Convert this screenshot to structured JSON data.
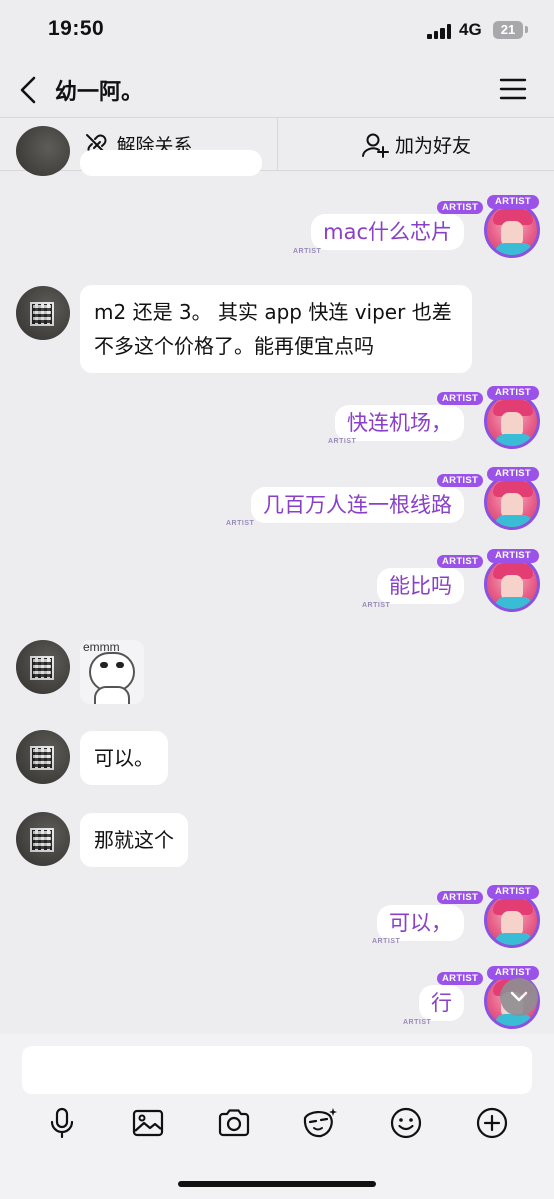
{
  "status_bar": {
    "time": "19:50",
    "network": "4G",
    "battery": "21"
  },
  "nav": {
    "title": "幼一阿。"
  },
  "actions": {
    "unlink": "解除关系",
    "add_friend": "加为好友"
  },
  "badge_text": "ARTIST",
  "messages": [
    {
      "side": "out",
      "text": "mac什么芯片"
    },
    {
      "side": "in",
      "text": "m2 还是 3。 其实 app 快连 viper 也差不多这个价格了。能再便宜点吗"
    },
    {
      "side": "out",
      "text": "快连机场，"
    },
    {
      "side": "out",
      "text": "几百万人连一根线路"
    },
    {
      "side": "out",
      "text": "能比吗"
    },
    {
      "side": "in",
      "type": "sticker",
      "text": "emmm"
    },
    {
      "side": "in",
      "text": "可以。"
    },
    {
      "side": "in",
      "text": "那就这个"
    },
    {
      "side": "out",
      "text": "可以，"
    },
    {
      "side": "out",
      "text": "行"
    }
  ],
  "input": {
    "value": "",
    "placeholder": ""
  },
  "toolbar": [
    "microphone-icon",
    "image-icon",
    "camera-icon",
    "ai-face-icon",
    "emoji-icon",
    "plus-icon"
  ],
  "colors": {
    "accent": "#8a3fc9",
    "badge": "#9a52e8",
    "background": "#ededf0"
  }
}
